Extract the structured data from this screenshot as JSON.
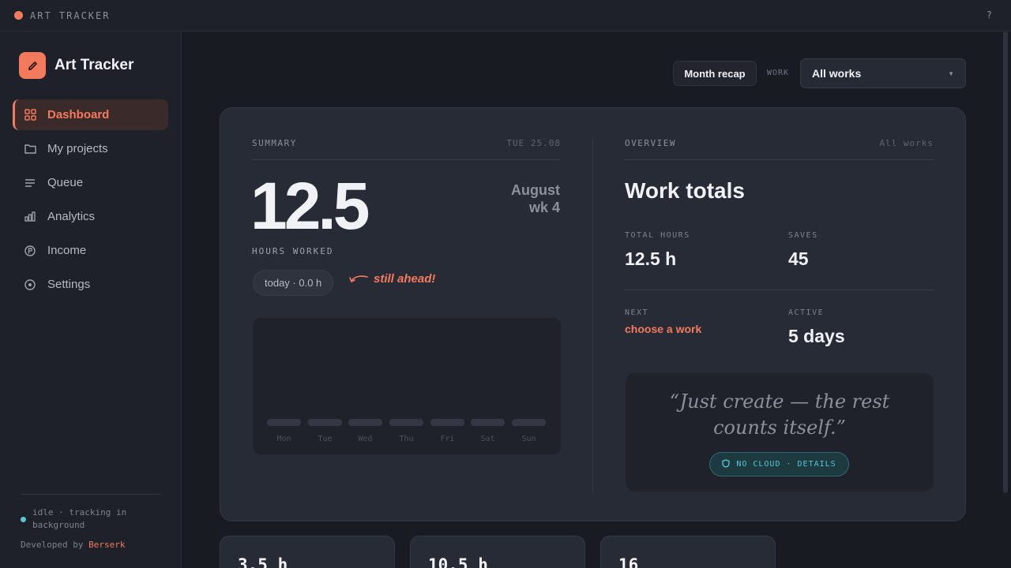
{
  "topbar": {
    "app_name": "ART TRACKER",
    "help": "?"
  },
  "sidebar": {
    "brand": "Art Tracker",
    "items": [
      {
        "label": "Dashboard",
        "icon": "grid-icon",
        "active": true
      },
      {
        "label": "My projects",
        "icon": "folder-icon"
      },
      {
        "label": "Queue",
        "icon": "list-icon"
      },
      {
        "label": "Analytics",
        "icon": "bar-chart-icon"
      },
      {
        "label": "Income",
        "icon": "coin-icon"
      },
      {
        "label": "Settings",
        "icon": "gear-icon"
      }
    ],
    "status": "idle · tracking in background",
    "developed_by": "Developed by",
    "author": "Berserk"
  },
  "header": {
    "recap_button": "Month recap",
    "work_label": "WORK",
    "work_selected": "All works"
  },
  "summary": {
    "label": "SUMMARY",
    "date": "TUE 25.08",
    "hours": "12.5",
    "month": "August",
    "week": "wk 4",
    "hours_label": "HOURS WORKED",
    "today": "today · 0.0 h",
    "ahead": "still ahead!",
    "days": [
      "Mon",
      "Tue",
      "Wed",
      "Thu",
      "Fri",
      "Sat",
      "Sun"
    ]
  },
  "overview": {
    "label": "OVERVIEW",
    "filter": "All works",
    "title": "Work totals",
    "total_hours_label": "TOTAL HOURS",
    "total_hours": "12.5 h",
    "saves_label": "SAVES",
    "saves": "45",
    "next_label": "NEXT",
    "next": "choose a work",
    "active_label": "ACTIVE",
    "active": "5 days",
    "quote": "“Just create — the rest counts itself.”",
    "badge": "NO CLOUD · DETAILS"
  },
  "bottom_cards": [
    "3.5 h",
    "10.5 h",
    "16"
  ],
  "colors": {
    "accent": "#f37b5d",
    "teal": "#56c7d8",
    "bg": "#191b22",
    "card": "#272b35"
  }
}
